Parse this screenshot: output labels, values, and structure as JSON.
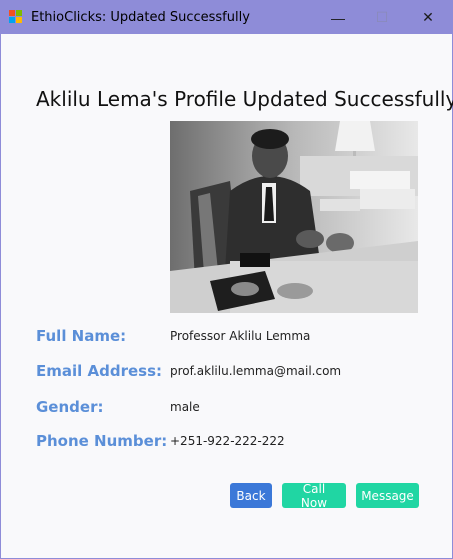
{
  "window": {
    "title": "EthioClicks: Updated Successfully",
    "controls": {
      "minimize": "—",
      "maximize": "☐",
      "close": "✕"
    }
  },
  "heading": "Aklilu Lema's Profile Updated Successfully",
  "profile": {
    "fields": [
      {
        "label": "Full Name:",
        "value": "Professor Aklilu Lemma"
      },
      {
        "label": "Email Address:",
        "value": "prof.aklilu.lemma@mail.com"
      },
      {
        "label": "Gender:",
        "value": "male"
      },
      {
        "label": "Phone Number:",
        "value": "+251-922-222-222"
      }
    ]
  },
  "buttons": {
    "back": "Back",
    "call": "Call Now",
    "message": "Message"
  },
  "colors": {
    "accent_label": "#5b8fd8",
    "back_button": "#3b78d8",
    "call_button": "#20d6a3",
    "message_button": "#20d6a3",
    "titlebar": "#8e8cd8"
  }
}
